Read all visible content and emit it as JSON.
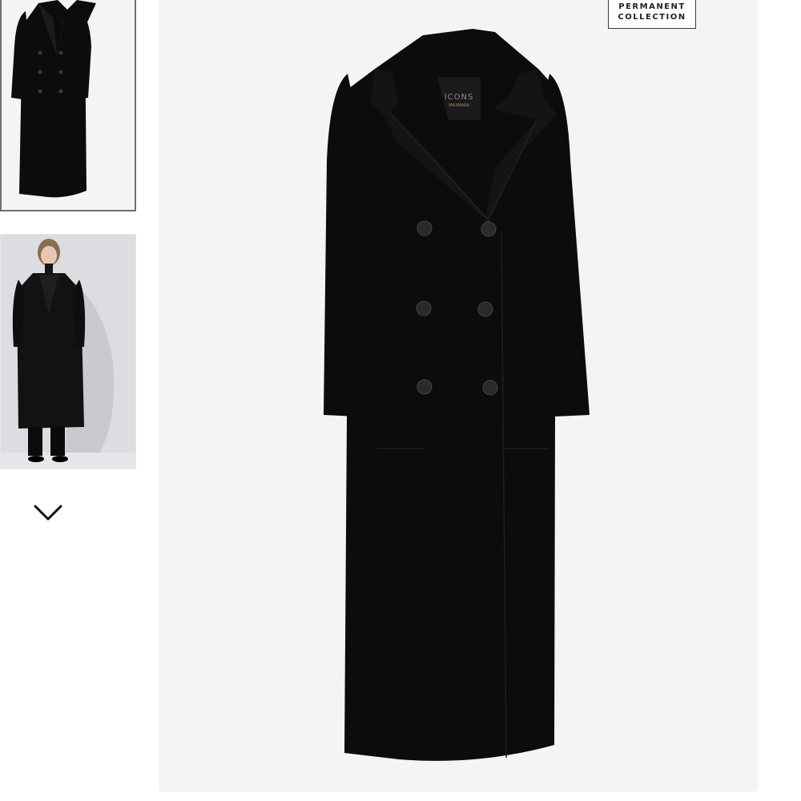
{
  "gallery": {
    "thumbnails": [
      {
        "icon": "coat-flatlay-thumbnail"
      },
      {
        "icon": "model-wearing-coat-thumbnail"
      }
    ],
    "more_icon": "chevron-down-icon"
  },
  "main_image": {
    "label_text": "ICONS",
    "label_subtext": "MAXMARA"
  },
  "badge": {
    "line1": "PERMANENT",
    "line2": "COLLECTION"
  },
  "colors": {
    "coat": "#0c0b0d",
    "background": "#f4f4f4",
    "thumb_border": "#6f6f6f"
  }
}
